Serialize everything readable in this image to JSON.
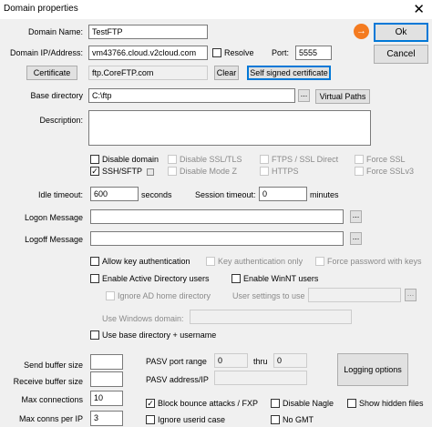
{
  "window": {
    "title": "Domain properties",
    "close_glyph": "✕"
  },
  "buttons": {
    "ok": "Ok",
    "cancel": "Cancel",
    "certificate": "Certificate",
    "clear": "Clear",
    "self_signed": "Self signed certificate",
    "browse": "...",
    "virtual_paths": "Virtual Paths",
    "logging_options": "Logging options"
  },
  "fields": {
    "domain_name": {
      "label": "Domain Name:",
      "value": "TestFTP"
    },
    "domain_ip": {
      "label": "Domain IP/Address:",
      "value": "vm43766.cloud.v2cloud.com"
    },
    "resolve": "Resolve",
    "port": {
      "label": "Port:",
      "value": "5555"
    },
    "cert_value": "ftp.CoreFTP.com",
    "base_directory": {
      "label": "Base directory",
      "value": "C:\\ftp"
    },
    "description": {
      "label": "Description:"
    },
    "idle_timeout": {
      "label": "Idle timeout:",
      "value": "600",
      "unit": "seconds"
    },
    "session_timeout": {
      "label": "Session timeout:",
      "value": "0",
      "unit": "minutes"
    },
    "logon_message": {
      "label": "Logon Message"
    },
    "logoff_message": {
      "label": "Logoff Message"
    },
    "user_settings_to_use": "User settings to use",
    "use_windows_domain": "Use Windows domain:",
    "send_buffer_size": "Send buffer size",
    "receive_buffer_size": "Receive buffer size",
    "max_connections": {
      "label": "Max connections",
      "value": "10"
    },
    "max_conns_per_ip": {
      "label": "Max conns per IP",
      "value": "3"
    },
    "pasv_port_range": {
      "label": "PASV port range",
      "from": "0",
      "thru_label": "thru",
      "to": "0"
    },
    "pasv_address": {
      "label": "PASV address/IP"
    }
  },
  "checkboxes": {
    "disable_domain": "Disable domain",
    "disable_ssl_tls": "Disable SSL/TLS",
    "ftps_ssl_direct": "FTPS / SSL Direct",
    "force_ssl": "Force SSL",
    "ssh_sftp": "SSH/SFTP",
    "disable_mode_z": "Disable Mode Z",
    "https": "HTTPS",
    "force_sslv3": "Force SSLv3",
    "allow_key_auth": "Allow key authentication",
    "key_auth_only": "Key authentication only",
    "force_password_with_keys": "Force password with keys",
    "enable_ad_users": "Enable Active Directory users",
    "enable_winnt_users": "Enable WinNT users",
    "ignore_ad_home": "Ignore AD home directory",
    "use_base_dir_username": "Use base directory + username",
    "block_bounce": "Block bounce attacks / FXP",
    "disable_nagle": "Disable Nagle",
    "show_hidden_files": "Show hidden files",
    "ignore_userid_case": "Ignore userid case",
    "no_gmt": "No GMT",
    "check_glyph": "✓"
  },
  "icons": {
    "go": "→"
  },
  "colors": {
    "accent": "#0078d7",
    "go_icon": "#f47b20"
  }
}
